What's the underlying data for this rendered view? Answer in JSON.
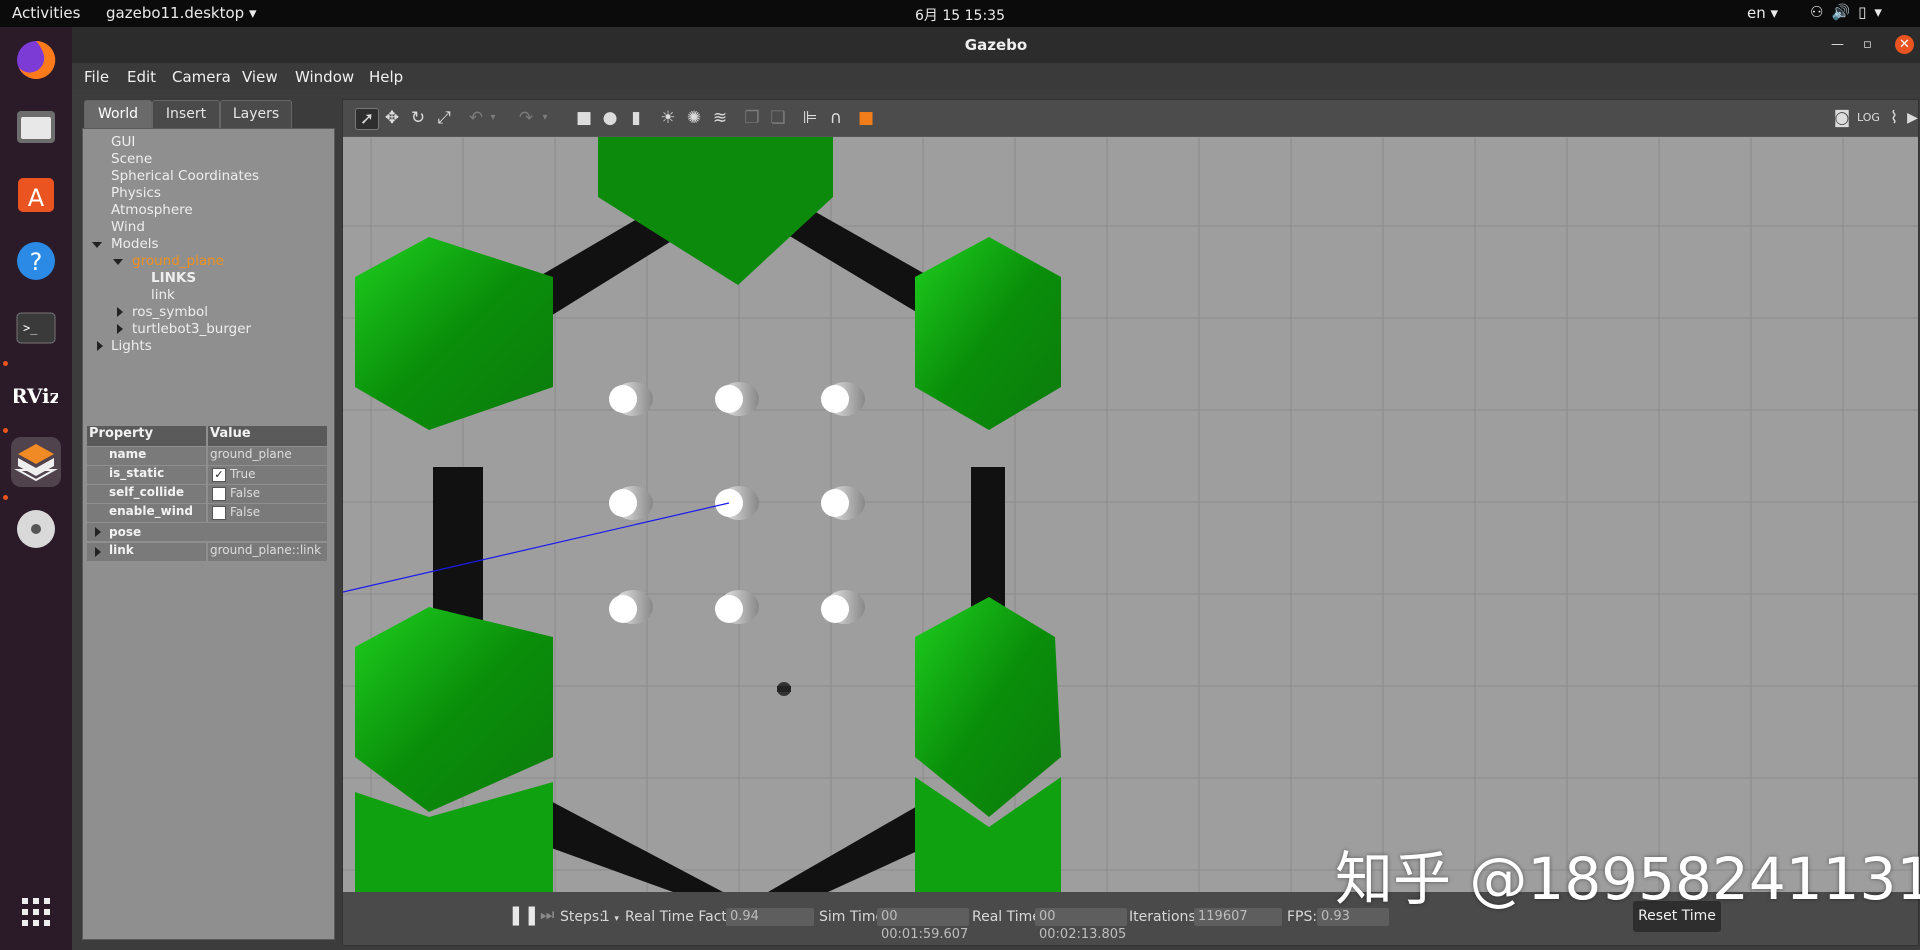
{
  "topbar": {
    "activities": "Activities",
    "app_name": "gazebo11.desktop ▾",
    "clock": "6月 15  15:35",
    "lang": "en ▾",
    "tray_icons": [
      "network-icon",
      "volume-icon",
      "battery-icon",
      "power-menu-icon"
    ]
  },
  "dock": {
    "items": [
      "firefox-icon",
      "files-icon",
      "software-center-icon",
      "help-icon",
      "terminal-icon",
      "rviz-icon",
      "gazebo-icon",
      "optical-disc-icon",
      "app-grid-icon"
    ],
    "active": "gazebo-icon"
  },
  "window": {
    "title": "Gazebo",
    "menu": [
      "File",
      "Edit",
      "Camera",
      "View",
      "Window",
      "Help"
    ]
  },
  "left_panel": {
    "tabs": [
      "World",
      "Insert",
      "Layers"
    ],
    "active_tab": "World",
    "tree": {
      "gui": "GUI",
      "scene": "Scene",
      "spherical": "Spherical Coordinates",
      "physics": "Physics",
      "atmosphere": "Atmosphere",
      "wind": "Wind",
      "models": "Models",
      "ground_plane": "ground_plane",
      "links": "LINKS",
      "link": "link",
      "ros_symbol": "ros_symbol",
      "turtlebot": "turtlebot3_burger",
      "lights": "Lights"
    },
    "properties": {
      "header_property": "Property",
      "header_value": "Value",
      "name_key": "name",
      "name_val": "ground_plane",
      "is_static_key": "is_static",
      "is_static_val": "True",
      "self_collide_key": "self_collide",
      "self_collide_val": "False",
      "enable_wind_key": "enable_wind",
      "enable_wind_val": "False",
      "pose_key": "pose",
      "link_key": "link",
      "link_val": "ground_plane::link"
    }
  },
  "toolbar": {
    "tools": [
      "select-mode-icon",
      "translate-mode-icon",
      "rotate-mode-icon",
      "scale-mode-icon",
      "undo-icon",
      "redo-icon",
      "box-shape-icon",
      "sphere-shape-icon",
      "cylinder-shape-icon",
      "point-light-icon",
      "spot-light-icon",
      "directional-light-icon",
      "copy-icon",
      "paste-icon",
      "align-icon",
      "snap-icon",
      "view-angle-icon"
    ],
    "right_tools": [
      "screenshot-icon",
      "log-icon",
      "plot-icon",
      "video-record-icon"
    ]
  },
  "bottombar": {
    "steps_label": "Steps:",
    "steps_value": "1",
    "rtf_label": "Real Time Factor:",
    "rtf_value": "0.94",
    "sim_time_label": "Sim Time:",
    "sim_time_value": "00 00:01:59.607",
    "real_time_label": "Real Time:",
    "real_time_value": "00 00:02:13.805",
    "iterations_label": "Iterations:",
    "iterations_value": "119607",
    "fps_label": "FPS:",
    "fps_value": "0.93",
    "reset_label": "Reset Time"
  },
  "watermark": "知乎 @18958241131",
  "colors": {
    "hex_green": "#11a011",
    "wall_black": "#111111",
    "grid": "#8a8a8a",
    "ground": "#9e9e9e",
    "laser": "#1a1aee",
    "accent_orange": "#e95420",
    "tree_selected": "#f0901e"
  }
}
